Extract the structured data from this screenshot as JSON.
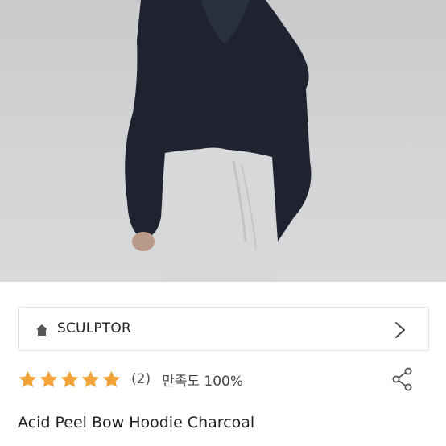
{
  "product": {
    "image_alt": "",
    "brand": "SCULPTOR",
    "rating_stars": 5,
    "review_count": "(2)",
    "satisfaction": "만족도 100%",
    "title": "Acid Peel Bow Hoodie Charcoal"
  },
  "colors": {
    "star": "#f2a43a",
    "text": "#222222",
    "border": "#e3e3e3",
    "icon": "#555555"
  },
  "icons": {
    "brand": "home-icon",
    "brand_nav": "chevron-right-icon",
    "share": "share-icon",
    "rating": "star-icon"
  }
}
